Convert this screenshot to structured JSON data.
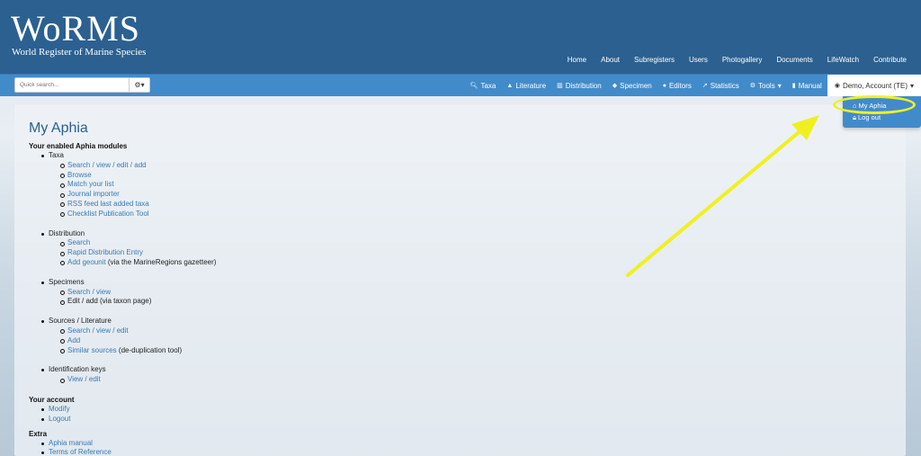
{
  "header": {
    "logo_title": "WoRMS",
    "logo_subtitle": "World Register of Marine Species",
    "top_links": [
      "Home",
      "About",
      "Subregisters",
      "Users",
      "Photogallery",
      "Documents",
      "LifeWatch",
      "Contribute"
    ]
  },
  "navbar": {
    "search_placeholder": "Quick search...",
    "items": [
      {
        "label": "Taxa",
        "icon": "search-icon"
      },
      {
        "label": "Literature",
        "icon": "graduation-cap-icon"
      },
      {
        "label": "Distribution",
        "icon": "map-icon"
      },
      {
        "label": "Specimen",
        "icon": "tag-icon"
      },
      {
        "label": "Editors",
        "icon": "users-icon"
      },
      {
        "label": "Statistics",
        "icon": "chart-icon"
      },
      {
        "label": "Tools",
        "icon": "cogs-icon"
      },
      {
        "label": "Manual",
        "icon": "book-icon"
      }
    ],
    "account_label": "Demo, Account (TE)"
  },
  "dropdown": {
    "items": [
      "My Aphia",
      "Log out"
    ]
  },
  "main": {
    "title": "My Aphia",
    "modules_heading": "Your enabled Aphia modules",
    "taxa": {
      "label": "Taxa",
      "links": [
        "Search / view / edit / add",
        "Browse",
        "Match your list",
        "Journal importer",
        "RSS feed last added taxa",
        "Checklist Publication Tool"
      ]
    },
    "distribution": {
      "label": "Distribution",
      "links": [
        "Search",
        "Rapid Distribution Entry"
      ],
      "geounit_link": "Add geounit",
      "geounit_suffix": " (via the MarineRegions gazetteer)"
    },
    "specimens": {
      "label": "Specimens",
      "link": "Search / view",
      "static": "Edit / add (via taxon page)"
    },
    "sources": {
      "label": "Sources / Literature",
      "links": [
        "Search / view / edit",
        "Add"
      ],
      "similar_link": "Similar sources",
      "similar_suffix": " (de-duplication tool)"
    },
    "idkeys": {
      "label": "Identification keys",
      "link": "View / edit"
    },
    "account_heading": "Your account",
    "account_links": [
      "Modify",
      "Logout"
    ],
    "extra_heading": "Extra",
    "extra_links": [
      "Aphia manual",
      "Terms of Reference"
    ]
  },
  "colors": {
    "banner": "#2b6091",
    "navbar": "#428bca",
    "link": "#3a7ab3",
    "annotation": "#f0f020"
  }
}
